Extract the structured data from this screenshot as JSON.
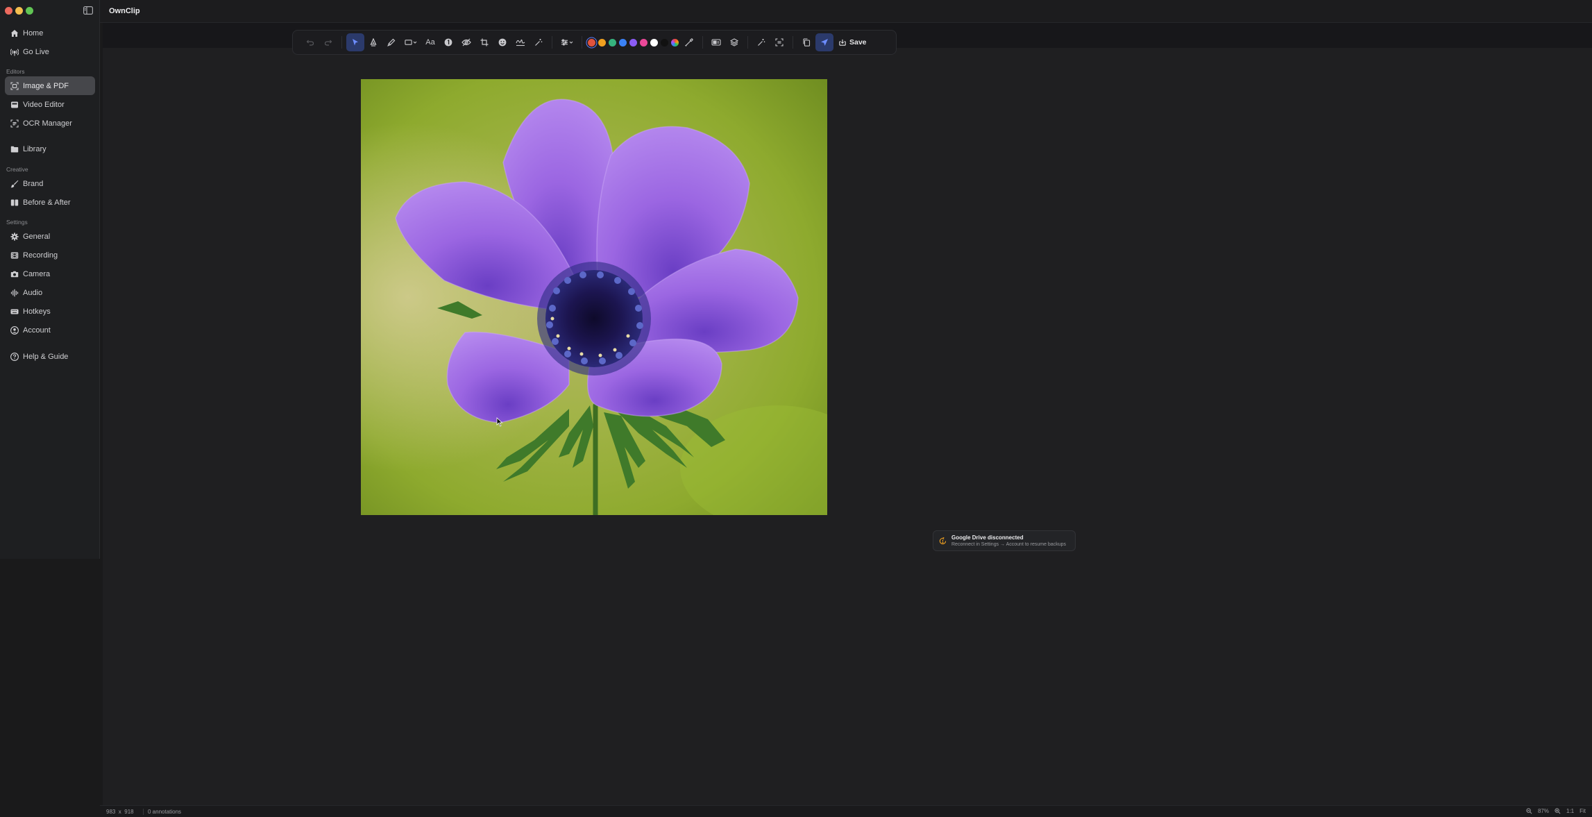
{
  "app": {
    "title": "OwnClip"
  },
  "window": {
    "traffic_colors": [
      "#ed6a5e",
      "#f5bf4f",
      "#61c554"
    ]
  },
  "sidebar": {
    "top_items": [
      {
        "label": "Home",
        "icon": "home-icon"
      },
      {
        "label": "Go Live",
        "icon": "broadcast-icon"
      }
    ],
    "editors_label": "Editors",
    "editors": [
      {
        "label": "Image & PDF",
        "icon": "image-scan-icon",
        "active": true
      },
      {
        "label": "Video Editor",
        "icon": "video-editor-icon"
      },
      {
        "label": "OCR Manager",
        "icon": "ocr-icon"
      }
    ],
    "library": {
      "label": "Library",
      "icon": "folder-icon"
    },
    "creative_label": "Creative",
    "creative": [
      {
        "label": "Brand",
        "icon": "brand-icon"
      },
      {
        "label": "Before & After",
        "icon": "compare-icon"
      }
    ],
    "settings_label": "Settings",
    "settings": [
      {
        "label": "General",
        "icon": "gear-icon"
      },
      {
        "label": "Recording",
        "icon": "film-icon"
      },
      {
        "label": "Camera",
        "icon": "camera-icon"
      },
      {
        "label": "Audio",
        "icon": "waveform-icon"
      },
      {
        "label": "Hotkeys",
        "icon": "keyboard-icon"
      },
      {
        "label": "Account",
        "icon": "user-circle-icon"
      }
    ],
    "help": {
      "label": "Help & Guide",
      "icon": "help-icon"
    }
  },
  "toolbar": {
    "text_tool_label": "Aa",
    "save_label": "Save",
    "colors": [
      "#e0533d",
      "#f0a020",
      "#36b37e",
      "#3b82f6",
      "#8b5cf6",
      "#ec4899",
      "#ffffff",
      "#111111"
    ],
    "selected_color": "#e0533d"
  },
  "status": {
    "dimensions": "983  x  918",
    "annotations": "0 annotations",
    "zoom": "87%",
    "zoom_reset": "1:1",
    "fit": "Fit"
  },
  "toast": {
    "title": "Google Drive disconnected",
    "message": "Reconnect in Settings → Account to resume backups",
    "accent": "#f0a020"
  }
}
